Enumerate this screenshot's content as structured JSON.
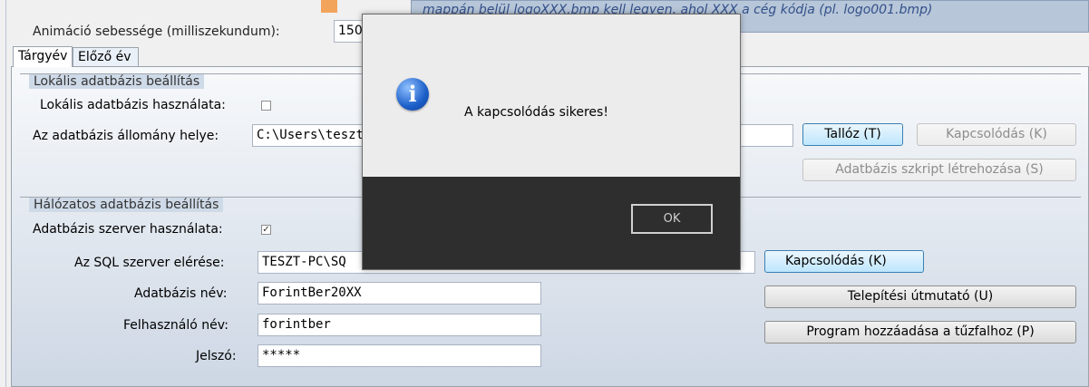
{
  "header": {
    "animation_label": "Animáció sebessége (milliszekundum):",
    "animation_value": "150",
    "info_note": "mappán belül logoXXX.bmp kell legyen, ahol XXX a cég kódja (pl. logo001.bmp)"
  },
  "tabs": [
    {
      "label": "Tárgyév",
      "active": true
    },
    {
      "label": "Előző év",
      "active": false
    }
  ],
  "local_db": {
    "group_title": "Lokális adatbázis beállítás",
    "use_label": "Lokális adatbázis használata:",
    "use_checked": false,
    "path_label": "Az adatbázis állomány helye:",
    "path_value": "C:\\Users\\teszt",
    "browse_button": "Tallóz (T)",
    "connect_button": "Kapcsolódás (K)",
    "script_button": "Adatbázis szkript létrehozása (S)"
  },
  "network_db": {
    "group_title": "Hálózatos adatbázis beállítás",
    "use_label": "Adatbázis szerver használata:",
    "use_checked": true,
    "server_label": "Az SQL szerver elérése:",
    "server_value": "TESZT-PC\\SQ",
    "dbname_label": "Adatbázis név:",
    "dbname_value": "ForintBer20XX",
    "user_label": "Felhasználó név:",
    "user_value": "forintber",
    "password_label": "Jelszó:",
    "password_value": "*****",
    "connect_button": "Kapcsolódás (K)",
    "install_guide_button": "Telepítési útmutató (U)",
    "firewall_button": "Program hozzáadása a tűzfalhoz (P)"
  },
  "dialog": {
    "icon": "info-icon",
    "message": "A kapcsolódás sikeres!",
    "ok_button": "OK"
  },
  "checkbox_glyph": "✓",
  "colors": {
    "accent_focus": "#3c7fb1",
    "info_box": "#b7c6d8",
    "dialog_footer": "#2e2e2e"
  }
}
